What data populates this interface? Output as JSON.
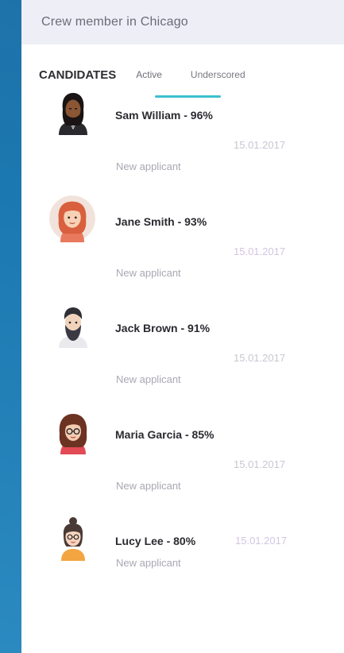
{
  "header": {
    "title": "Crew member in Chicago"
  },
  "tabs": {
    "title": "CANDIDATES",
    "active": "Active",
    "underscored": "Underscored"
  },
  "candidates": [
    {
      "name": "Sam William - 96%",
      "date": "15.01.2017",
      "status": "New applicant"
    },
    {
      "name": "Jane Smith - 93%",
      "date": "15.01.2017",
      "status": "New applicant"
    },
    {
      "name": "Jack Brown - 91%",
      "date": "15.01.2017",
      "status": "New applicant"
    },
    {
      "name": "Maria Garcia - 85%",
      "date": "15.01.2017",
      "status": "New applicant"
    },
    {
      "name": "Lucy Lee - 80%",
      "date": "15.01.2017",
      "status": "New applicant"
    }
  ],
  "colors": {
    "accent": "#3cc0cf",
    "background": "#1c78b0",
    "header_bg": "#eeeef7"
  },
  "icons": [
    "avatar-sam",
    "avatar-jane",
    "avatar-jack",
    "avatar-maria",
    "avatar-lucy"
  ]
}
